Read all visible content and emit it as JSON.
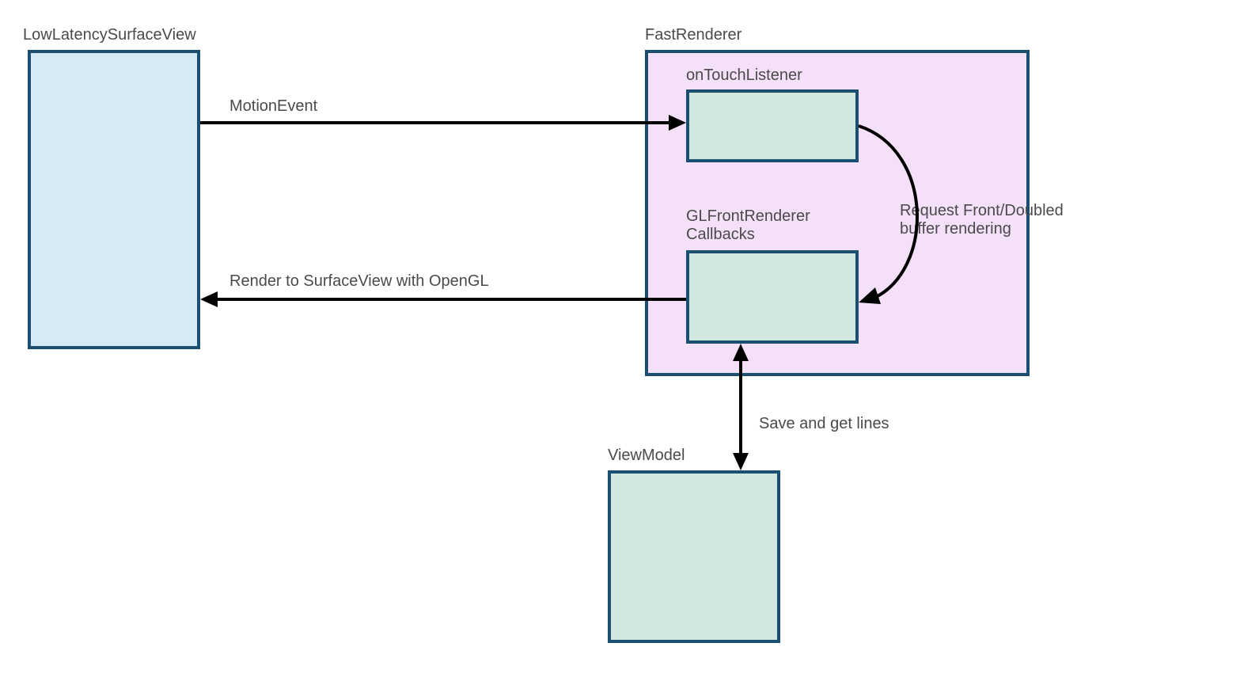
{
  "nodes": {
    "surfaceView": {
      "label": "LowLatencySurfaceView"
    },
    "fastRenderer": {
      "label": "FastRenderer"
    },
    "onTouchListener": {
      "label": "onTouchListener"
    },
    "glCallbacks": {
      "label": "GLFrontRenderer\nCallbacks"
    },
    "viewModel": {
      "label": "ViewModel"
    }
  },
  "edges": {
    "motionEvent": {
      "label": "MotionEvent"
    },
    "requestBuffer": {
      "label": "Request Front/Doubled\nbuffer rendering"
    },
    "renderOpenGL": {
      "label": "Render to SurfaceView with OpenGL"
    },
    "saveGetLines": {
      "label": "Save and get lines"
    }
  },
  "colors": {
    "boxBorder": "#1b4f72",
    "boxBlue": "#d6eaf5",
    "boxGreen": "#d1e8df",
    "boxPurple": "#f5e0f9",
    "arrow": "#000000",
    "text": "#4a4a4a"
  }
}
